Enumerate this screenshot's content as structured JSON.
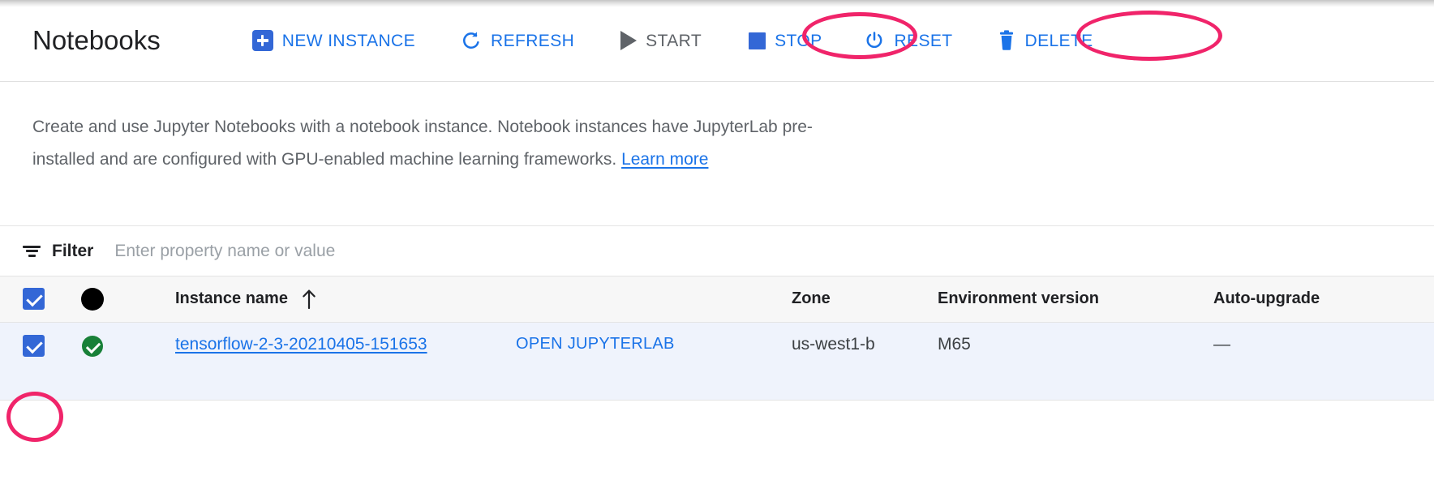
{
  "header": {
    "title": "Notebooks",
    "toolbar": [
      {
        "id": "new-instance",
        "label": "NEW INSTANCE",
        "icon": "plus-square-icon",
        "state": "enabled",
        "color": "#1a73e8"
      },
      {
        "id": "refresh",
        "label": "REFRESH",
        "icon": "refresh-icon",
        "state": "enabled",
        "color": "#1a73e8"
      },
      {
        "id": "start",
        "label": "START",
        "icon": "play-icon",
        "state": "disabled",
        "color": "#5f6368"
      },
      {
        "id": "stop",
        "label": "STOP",
        "icon": "stop-square-icon",
        "state": "enabled",
        "color": "#1a73e8"
      },
      {
        "id": "reset",
        "label": "RESET",
        "icon": "power-reset-icon",
        "state": "enabled",
        "color": "#1a73e8"
      },
      {
        "id": "delete",
        "label": "DELETE",
        "icon": "trash-icon",
        "state": "enabled",
        "color": "#1a73e8"
      }
    ]
  },
  "description": {
    "text": "Create and use Jupyter Notebooks with a notebook instance. Notebook instances have JupyterLab pre-installed and are configured with GPU-enabled machine learning frameworks.",
    "link_label": "Learn more"
  },
  "filter": {
    "icon": "filter-icon",
    "label": "Filter",
    "placeholder": "Enter property name or value",
    "value": ""
  },
  "table": {
    "columns": [
      {
        "id": "select",
        "label": "",
        "icon": "checkbox-checked-icon"
      },
      {
        "id": "status",
        "label": "",
        "icon": "status-dot-icon"
      },
      {
        "id": "name",
        "label": "Instance name",
        "sort": "ascending",
        "sort_icon": "arrow-up-icon"
      },
      {
        "id": "open",
        "label": ""
      },
      {
        "id": "zone",
        "label": "Zone"
      },
      {
        "id": "env",
        "label": "Environment version"
      },
      {
        "id": "auto",
        "label": "Auto-upgrade"
      }
    ],
    "rows": [
      {
        "selected": true,
        "status": "healthy",
        "status_icon": "check-circle-icon",
        "name": "tensorflow-2-3-20210405-151653",
        "action_label": "OPEN JUPYTERLAB",
        "zone": "us-west1-b",
        "environment_version": "M65",
        "auto_upgrade": "—"
      }
    ]
  },
  "annotations": {
    "color": "#f0246a",
    "targets": [
      "stop-button",
      "delete-button",
      "row-checkbox"
    ]
  }
}
